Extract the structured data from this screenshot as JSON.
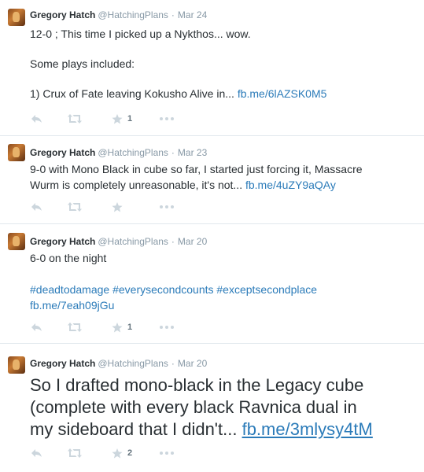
{
  "tweets": [
    {
      "name": "Gregory Hatch",
      "handle": "@HatchingPlans",
      "separator": "·",
      "date": "Mar 24",
      "line1": "12-0 ; This time I picked up a Nykthos... wow.",
      "line2": "Some plays included:",
      "line3": "1) Crux of Fate leaving Kokusho Alive in...",
      "link": "fb.me/6lAZSK0M5",
      "favorites": "1"
    },
    {
      "name": "Gregory Hatch",
      "handle": "@HatchingPlans",
      "separator": "·",
      "date": "Mar 23",
      "line1": "9-0 with Mono Black in cube so far, I started just forcing it, Massacre",
      "line2": "Wurm is completely unreasonable, it's not...",
      "link": "fb.me/4uZY9aQAy",
      "favorites": ""
    },
    {
      "name": "Gregory Hatch",
      "handle": "@HatchingPlans",
      "separator": "·",
      "date": "Mar 20",
      "line1": "6-0 on the night",
      "hashtags": "#deadtodamage #everysecondcounts #exceptsecondplace",
      "link": "fb.me/7eah09jGu",
      "favorites": "1"
    },
    {
      "name": "Gregory Hatch",
      "handle": "@HatchingPlans",
      "separator": "·",
      "date": "Mar 20",
      "line1": "So I drafted mono-black in the Legacy cube",
      "line2": "(complete with every black Ravnica dual in",
      "line3": "my sideboard that I didn't...",
      "link": "fb.me/3mlysy4tM",
      "favorites": "2"
    }
  ],
  "icons": {
    "reply": "reply-icon",
    "retweet": "retweet-icon",
    "favorite": "star-icon",
    "more": "more-icon"
  },
  "colors": {
    "link": "#2b7bb9",
    "muted": "#8899a6",
    "icon": "#ccd6dd",
    "divider": "#e1e8ed"
  }
}
